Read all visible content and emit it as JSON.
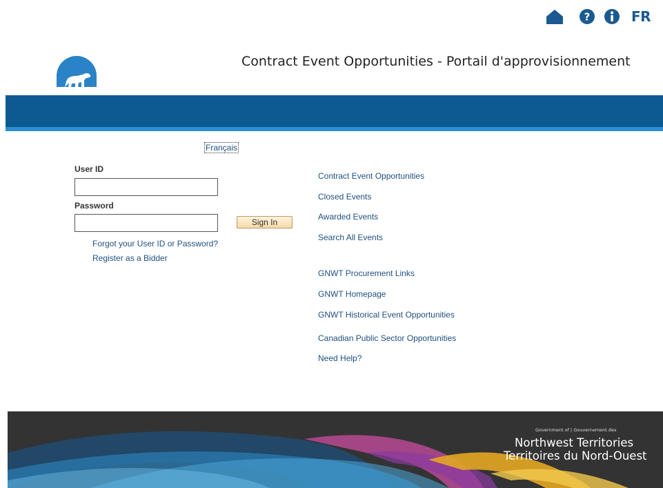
{
  "header": {
    "title": "Contract Event Opportunities - Portail d'approvisionnement",
    "lang_toggle": "FR",
    "icons": [
      "home-icon",
      "help-icon",
      "info-icon"
    ]
  },
  "language_link": "Français",
  "login": {
    "user_id_label": "User ID",
    "user_id_value": "",
    "password_label": "Password",
    "password_value": "",
    "sign_in": "Sign In",
    "forgot": "Forgot your User ID or Password?",
    "register": "Register as a Bidder"
  },
  "links": {
    "events": [
      "Contract Event Opportunities",
      "Closed Events",
      "Awarded Events",
      "Search All Events"
    ],
    "resources": [
      "GNWT Procurement Links",
      "GNWT Homepage",
      "GNWT Historical Event Opportunities",
      "Canadian Public Sector Opportunities",
      "Need Help?"
    ]
  },
  "footer": {
    "gov_small": "Government of | Gouvernement des",
    "line1": "Northwest Territories",
    "line2": "Territoires du Nord-Ouest"
  },
  "colors": {
    "brand_blue": "#0d5a92",
    "stripe_blue": "#2a8fd0",
    "link": "#1f4f80",
    "icon": "#1b5a90"
  }
}
